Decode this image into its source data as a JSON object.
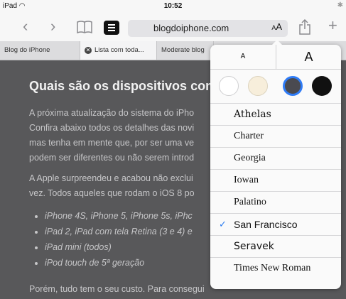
{
  "status_bar": {
    "device": "iPad",
    "time": "10:52"
  },
  "toolbar": {
    "url": "blogdoiphone.com",
    "text_size_label_small": "A",
    "text_size_label_large": "A"
  },
  "tabs": [
    {
      "label": "Blog do iPhone"
    },
    {
      "label": "Lista com toda..."
    },
    {
      "label": "Moderate blog"
    }
  ],
  "article": {
    "title": "Quais são os dispositivos comp",
    "para1": [
      "A próxima atualização do sistema do iPho",
      "Confira abaixo todos os detalhes das novi",
      "mas tenha em mente que, por ser uma ve",
      "podem ser diferentes ou não serem introd"
    ],
    "para2": [
      "A Apple surpreendeu e acabou não exclui",
      "vez. Todos aqueles que rodam o iOS 8 po"
    ],
    "bullets": [
      "iPhone 4S, iPhone 5, iPhone 5s, iPhc",
      "iPad 2, iPad com tela Retina (3 e 4) e",
      "iPad mini (todos)",
      "iPod touch de 5ª geração"
    ],
    "para3": "Porém, tudo tem o seu custo. Para consegui"
  },
  "reader_popover": {
    "size_small": "A",
    "size_large": "A",
    "themes": [
      {
        "name": "white",
        "color": "#ffffff"
      },
      {
        "name": "sepia",
        "color": "#f7eedb"
      },
      {
        "name": "gray",
        "color": "#4a4a50"
      },
      {
        "name": "night",
        "color": "#111111"
      }
    ],
    "selected_theme": "gray",
    "fonts": [
      {
        "label": "Athelas"
      },
      {
        "label": "Charter"
      },
      {
        "label": "Georgia"
      },
      {
        "label": "Iowan"
      },
      {
        "label": "Palatino"
      },
      {
        "label": "San Francisco"
      },
      {
        "label": "Seravek"
      },
      {
        "label": "Times New Roman"
      }
    ],
    "selected_font": "San Francisco",
    "check_mark": "✓"
  }
}
